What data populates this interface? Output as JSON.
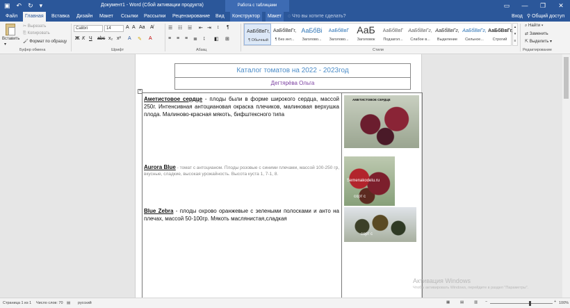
{
  "window": {
    "title": "Документ1 - Word (Сбой активации продукта)",
    "context_group": "Работа с таблицами",
    "minimize": "—",
    "restore": "❐",
    "close": "✕"
  },
  "tabs": [
    {
      "label": "Файл"
    },
    {
      "label": "Главная"
    },
    {
      "label": "Вставка"
    },
    {
      "label": "Дизайн"
    },
    {
      "label": "Макет"
    },
    {
      "label": "Ссылки"
    },
    {
      "label": "Рассылки"
    },
    {
      "label": "Рецензирование"
    },
    {
      "label": "Вид"
    },
    {
      "label": "Конструктор"
    },
    {
      "label": "Макет"
    }
  ],
  "tellme": "Что вы хотите сделать?",
  "account": {
    "login": "Вход",
    "share": "Общий доступ"
  },
  "ribbon": {
    "clipboard": {
      "paste": "Вставить",
      "cut": "Вырезать",
      "copy": "Копировать",
      "format_painter": "Формат по образцу",
      "label": "Буфер обмена"
    },
    "font": {
      "name": "Calibri",
      "size": "14",
      "label": "Шрифт"
    },
    "paragraph": {
      "label": "Абзац"
    },
    "styles": {
      "label": "Стили",
      "items": [
        {
          "sample": "АаБбВвГг,",
          "name": "¶ Обычный"
        },
        {
          "sample": "АаБбВвГг,",
          "name": "¶ Без инт..."
        },
        {
          "sample": "АаБбВі",
          "name": "Заголово..."
        },
        {
          "sample": "АаБбВвГ",
          "name": "Заголово..."
        },
        {
          "sample": "АаБ",
          "name": "Заголовок"
        },
        {
          "sample": "АаБбВвГ",
          "name": "Подзагол..."
        },
        {
          "sample": "АаБбВвГг,",
          "name": "Слабое в..."
        },
        {
          "sample": "АаБбВвГг,",
          "name": "Выделение"
        },
        {
          "sample": "АаБбВвГг,",
          "name": "Сильное..."
        },
        {
          "sample": "АаБбВвГг,",
          "name": "Строгий"
        }
      ]
    },
    "editing": {
      "find": "Найти",
      "replace": "Заменить",
      "select": "Выделить",
      "label": "Редактирование"
    }
  },
  "document": {
    "title": "Каталог томатов на 2022 - 2023год",
    "author": "Дегтярёва Ольга",
    "entries": [
      {
        "name": "Аметистовое сердце",
        "text": " - плоды были в форме широкого сердца, массой 250г. Интенсивная антоциановая окраска плечиков, малиновая верхушка плода. Малиново-красная мякоть, бифштексного типа"
      },
      {
        "name": "Aurora Blue",
        "text": " - томат с антоцианом. Плоды розовые с синими плечами, массой 100-250 гр, вкусные, сладкие, высокая урожайность. Высота куста 1, 7-1, 8."
      },
      {
        "name": "Blue Zebra",
        "text": " - плоды охрово оранжевые с зелеными полосками и анто на плечах, массой 50-100гр. Мякоть маслянистая,сладкая"
      }
    ],
    "photos": [
      {
        "caption": "АМЕТИСТОВОЕ СЕРДЦЕ"
      },
      {
        "caption": "Semenakodelu.ru",
        "caption2": "сорт с"
      },
      {
        "caption": "сорт с"
      }
    ]
  },
  "statusbar": {
    "page": "Страница 1 из 1",
    "words": "Число слов: 70",
    "lang": "русский",
    "zoom": "100%"
  },
  "activation": {
    "line1": "Активация Windows",
    "line2": "Чтобы активировать Windows, перейдите в раздел \"Параметры\"."
  }
}
